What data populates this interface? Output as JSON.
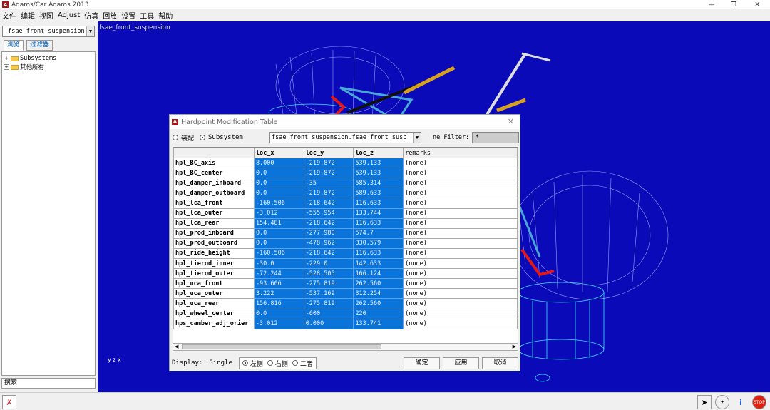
{
  "app": {
    "title": "Adams/Car Adams 2013"
  },
  "menu": [
    "文件",
    "编辑",
    "视图",
    "Adjust",
    "仿真",
    "回放",
    "设置",
    "工具",
    "帮助"
  ],
  "left": {
    "selector": ".fsae_front_suspension",
    "tabs": [
      "浏览",
      "过滤器"
    ],
    "tree": [
      "Subsystems",
      "其他所有"
    ],
    "search": "搜索"
  },
  "viewport": {
    "label": "fsae_front_suspension"
  },
  "dialog": {
    "title": "Hardpoint Modification Table",
    "mode_options": [
      "装配",
      "Subsystem"
    ],
    "subsystem_select": "fsae_front_suspension.fsae_front_susp",
    "filter_label": "ne Filter:",
    "filter_value": "*",
    "columns": [
      "loc_x",
      "loc_y",
      "loc_z",
      "remarks"
    ],
    "rows": [
      {
        "name": "hpl_BC_axis",
        "x": "8.000",
        "y": "-219.872",
        "z": "539.133",
        "r": "(none)"
      },
      {
        "name": "hpl_BC_center",
        "x": "0.0",
        "y": "-219.872",
        "z": "539.133",
        "r": "(none)"
      },
      {
        "name": "hpl_damper_inboard",
        "x": "0.0",
        "y": "-35",
        "z": "585.314",
        "r": "(none)"
      },
      {
        "name": "hpl_damper_outboard",
        "x": "0.0",
        "y": "-219.872",
        "z": "589.633",
        "r": "(none)"
      },
      {
        "name": "hpl_lca_front",
        "x": "-160.506",
        "y": "-218.642",
        "z": "116.633",
        "r": "(none)"
      },
      {
        "name": "hpl_lca_outer",
        "x": "-3.012",
        "y": "-555.954",
        "z": "133.744",
        "r": "(none)"
      },
      {
        "name": "hpl_lca_rear",
        "x": "154.481",
        "y": "-218.642",
        "z": "116.633",
        "r": "(none)"
      },
      {
        "name": "hpl_prod_inboard",
        "x": "0.0",
        "y": "-277.980",
        "z": "574.7",
        "r": "(none)"
      },
      {
        "name": "hpl_prod_outboard",
        "x": "0.0",
        "y": "-478.962",
        "z": "330.579",
        "r": "(none)"
      },
      {
        "name": "hpl_ride_height",
        "x": "-160.506",
        "y": "-218.642",
        "z": "116.633",
        "r": "(none)"
      },
      {
        "name": "hpl_tierod_inner",
        "x": "-30.0",
        "y": "-229.0",
        "z": "142.633",
        "r": "(none)"
      },
      {
        "name": "hpl_tierod_outer",
        "x": "-72.244",
        "y": "-528.505",
        "z": "166.124",
        "r": "(none)"
      },
      {
        "name": "hpl_uca_front",
        "x": "-93.606",
        "y": "-275.819",
        "z": "262.560",
        "r": "(none)"
      },
      {
        "name": "hpl_uca_outer",
        "x": "3.222",
        "y": "-537.169",
        "z": "312.254",
        "r": "(none)"
      },
      {
        "name": "hpl_uca_rear",
        "x": "156.816",
        "y": "-275.819",
        "z": "262.560",
        "r": "(none)"
      },
      {
        "name": "hpl_wheel_center",
        "x": "0.0",
        "y": "-600",
        "z": "220",
        "r": "(none)"
      },
      {
        "name": "hps_camber_adj_orier",
        "x": "-3.012",
        "y": "0.000",
        "z": "133.741",
        "r": "(none)"
      }
    ],
    "display_label": "Display:",
    "display_value": "Single",
    "side_options": [
      "左侧",
      "右侧",
      "二者"
    ],
    "buttons": {
      "ok": "确定",
      "apply": "应用",
      "cancel": "取消"
    }
  },
  "colors": {
    "viewport_bg": "#0a0ab8",
    "selection": "#0a74da"
  }
}
